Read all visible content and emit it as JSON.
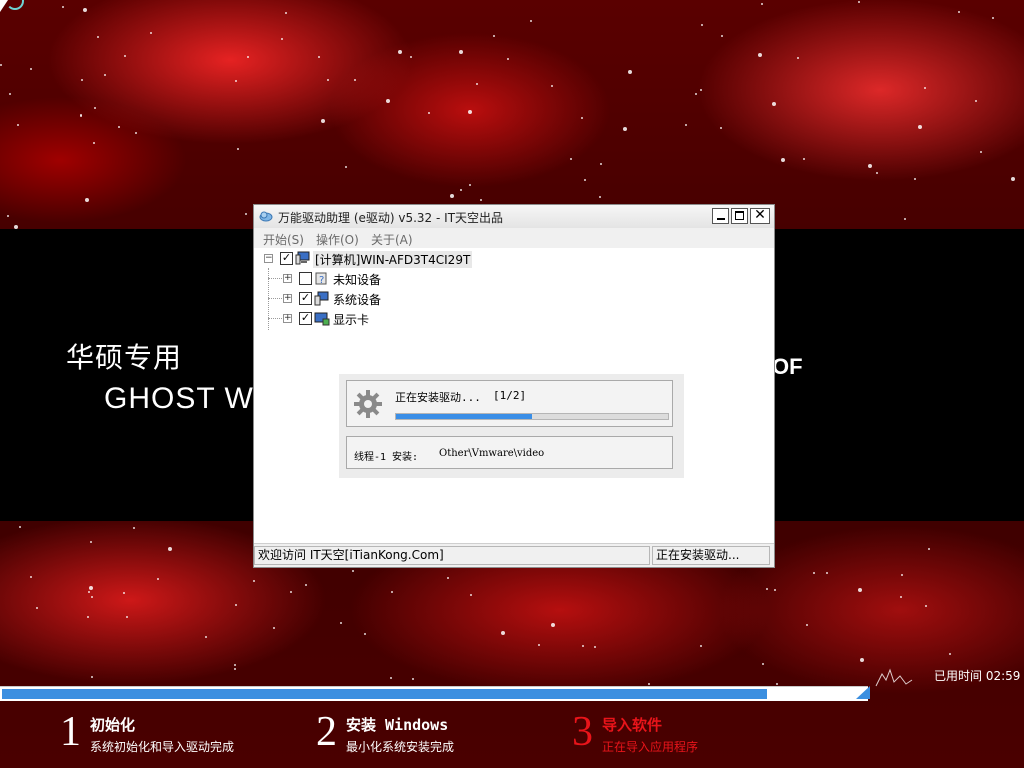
{
  "desktop": {
    "band_line1": "华硕专用",
    "band_line2": "GHOST WIN",
    "band_right": "OF"
  },
  "window": {
    "title": "万能驱动助理 (e驱动) v5.32 - IT天空出品",
    "min_label": "",
    "max_label": "",
    "close_label": "✕",
    "menu": [
      "开始(S)",
      "操作(O)",
      "关于(A)"
    ],
    "tree": {
      "root": {
        "label": "[计算机]WIN-AFD3T4CI29T",
        "checked": true
      },
      "children": [
        {
          "label": "未知设备",
          "checked": false
        },
        {
          "label": "系统设备",
          "checked": true
        },
        {
          "label": "显示卡",
          "checked": true
        }
      ]
    },
    "install": {
      "status": "正在安装驱动...",
      "count": "[1/2]",
      "progress": 0.5,
      "thread_label": "线程-1 安装:",
      "thread_path": "Other\\Vmware\\video"
    },
    "statusbar": {
      "left": "欢迎访问 IT天空[iTianKong.Com]",
      "right": "正在安装驱动..."
    }
  },
  "setup": {
    "overall_progress": 0.885,
    "elapsed_label": "已用时间",
    "elapsed_value": "02:59",
    "steps": [
      {
        "num": "1",
        "title": "初始化",
        "desc": "系统初始化和导入驱动完成",
        "state": "done"
      },
      {
        "num": "2",
        "title": "安装 Windows",
        "desc": "最小化系统安装完成",
        "state": "done"
      },
      {
        "num": "3",
        "title": "导入软件",
        "desc": "正在导入应用程序",
        "state": "active"
      }
    ]
  },
  "colors": {
    "progress_blue": "#3b8fe0",
    "active_step": "#e8141a"
  }
}
